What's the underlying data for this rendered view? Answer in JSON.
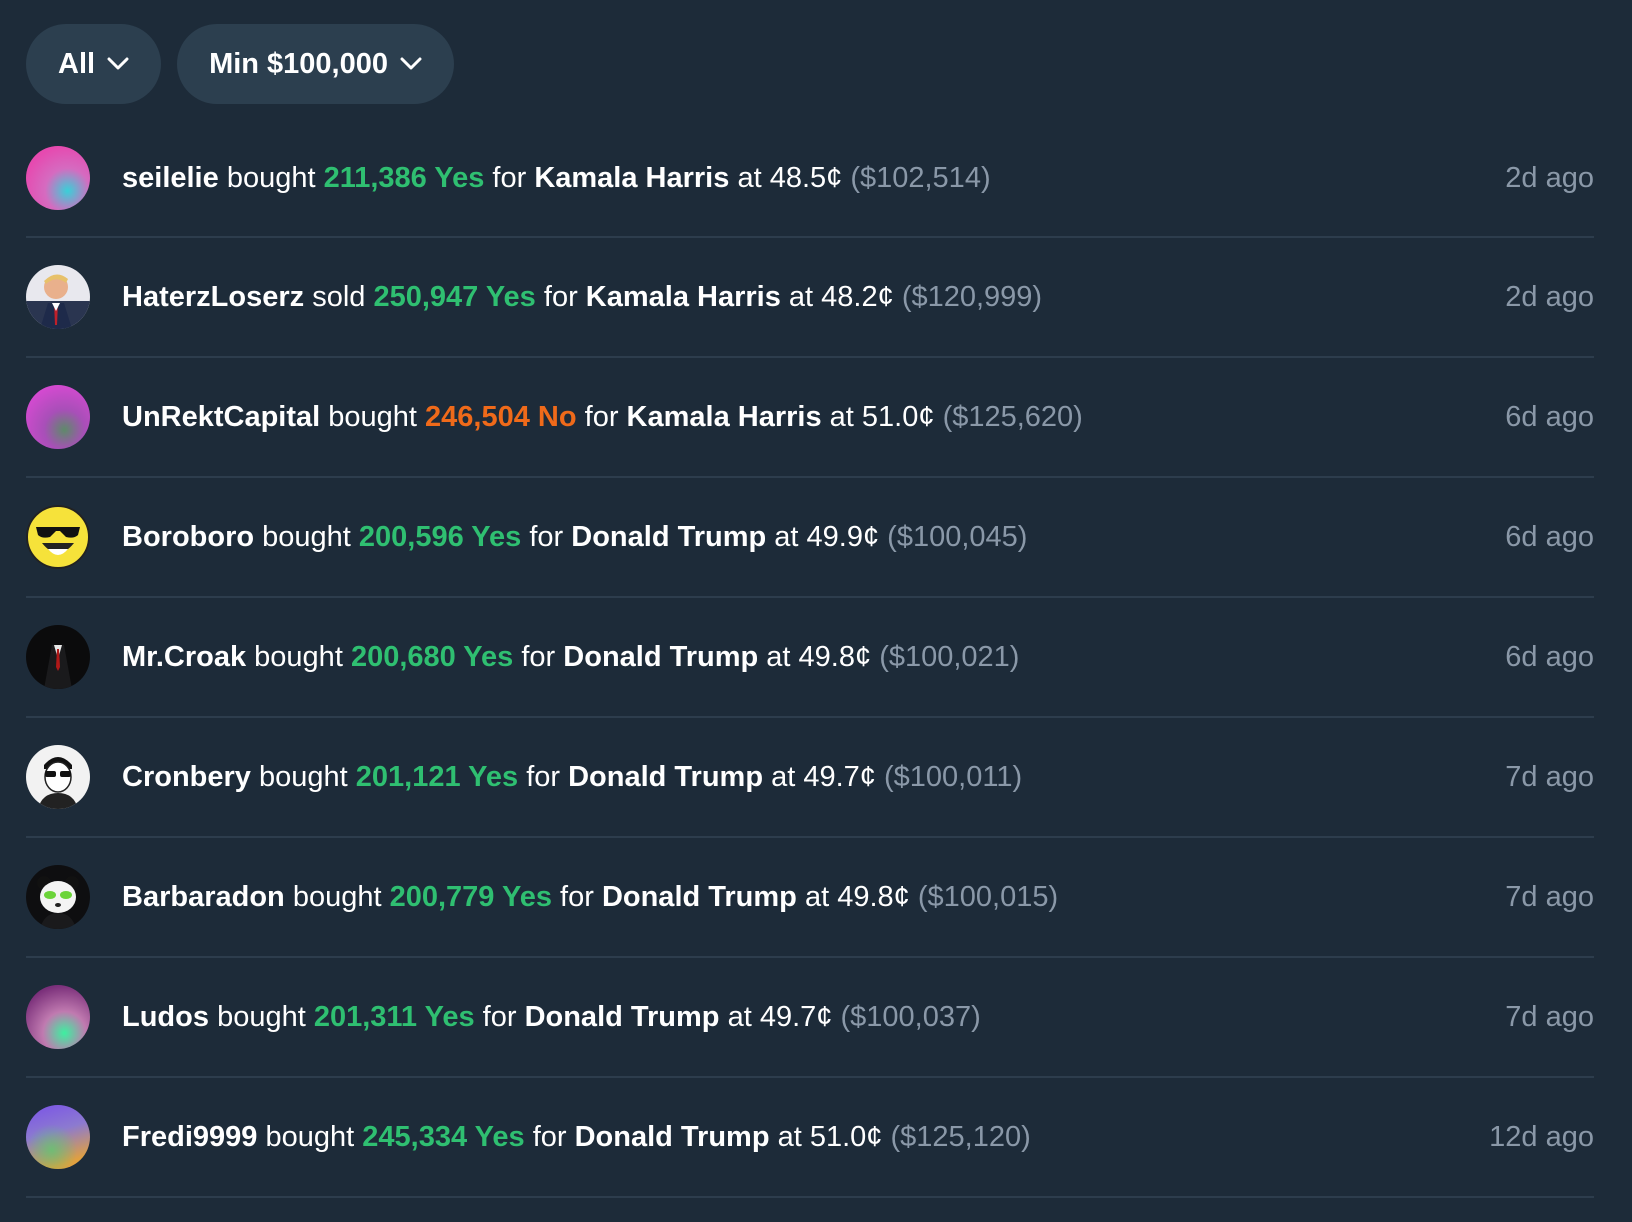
{
  "filters": {
    "type_label": "All",
    "min_label": "Min $100,000"
  },
  "trades": [
    {
      "user": "seilelie",
      "action": "bought",
      "shares": "211,386 Yes",
      "side": "yes",
      "for": "for",
      "market": "Kamala Harris",
      "at": "at",
      "price": "48.5¢",
      "usd": "($102,514)",
      "time": "2d ago",
      "avatar_icon": "gradient-avatar-pink-teal"
    },
    {
      "user": "HaterzLoserz",
      "action": "sold",
      "shares": "250,947 Yes",
      "side": "yes",
      "for": "for",
      "market": "Kamala Harris",
      "at": "at",
      "price": "48.2¢",
      "usd": "($120,999)",
      "time": "2d ago",
      "avatar_icon": "photo-avatar-man-suit"
    },
    {
      "user": "UnRektCapital",
      "action": "bought",
      "shares": "246,504 No",
      "side": "no",
      "for": "for",
      "market": "Kamala Harris",
      "at": "at",
      "price": "51.0¢",
      "usd": "($125,620)",
      "time": "6d ago",
      "avatar_icon": "gradient-avatar-magenta-green"
    },
    {
      "user": "Boroboro",
      "action": "bought",
      "shares": "200,596 Yes",
      "side": "yes",
      "for": "for",
      "market": "Donald Trump",
      "at": "at",
      "price": "49.9¢",
      "usd": "($100,045)",
      "time": "6d ago",
      "avatar_icon": "sunglasses-smiley-avatar"
    },
    {
      "user": "Mr.Croak",
      "action": "bought",
      "shares": "200,680 Yes",
      "side": "yes",
      "for": "for",
      "market": "Donald Trump",
      "at": "at",
      "price": "49.8¢",
      "usd": "($100,021)",
      "time": "6d ago",
      "avatar_icon": "suit-silhouette-avatar"
    },
    {
      "user": "Cronbery",
      "action": "bought",
      "shares": "201,121 Yes",
      "side": "yes",
      "for": "for",
      "market": "Donald Trump",
      "at": "at",
      "price": "49.7¢",
      "usd": "($100,011)",
      "time": "7d ago",
      "avatar_icon": "sunglasses-sketch-avatar"
    },
    {
      "user": "Barbaradon",
      "action": "bought",
      "shares": "200,779 Yes",
      "side": "yes",
      "for": "for",
      "market": "Donald Trump",
      "at": "at",
      "price": "49.8¢",
      "usd": "($100,015)",
      "time": "7d ago",
      "avatar_icon": "panda-avatar"
    },
    {
      "user": "Ludos",
      "action": "bought",
      "shares": "201,311 Yes",
      "side": "yes",
      "for": "for",
      "market": "Donald Trump",
      "at": "at",
      "price": "49.7¢",
      "usd": "($100,037)",
      "time": "7d ago",
      "avatar_icon": "gradient-avatar-purple-green"
    },
    {
      "user": "Fredi9999",
      "action": "bought",
      "shares": "245,334 Yes",
      "side": "yes",
      "for": "for",
      "market": "Donald Trump",
      "at": "at",
      "price": "51.0¢",
      "usd": "($125,120)",
      "time": "12d ago",
      "avatar_icon": "gradient-avatar-violet-orange"
    }
  ],
  "colors": {
    "background": "#1d2b39",
    "pill": "#2c3f4f",
    "yes": "#2fbf71",
    "no": "#ef6a1a",
    "muted": "#8a98a8",
    "divider": "#2d3d4d"
  }
}
